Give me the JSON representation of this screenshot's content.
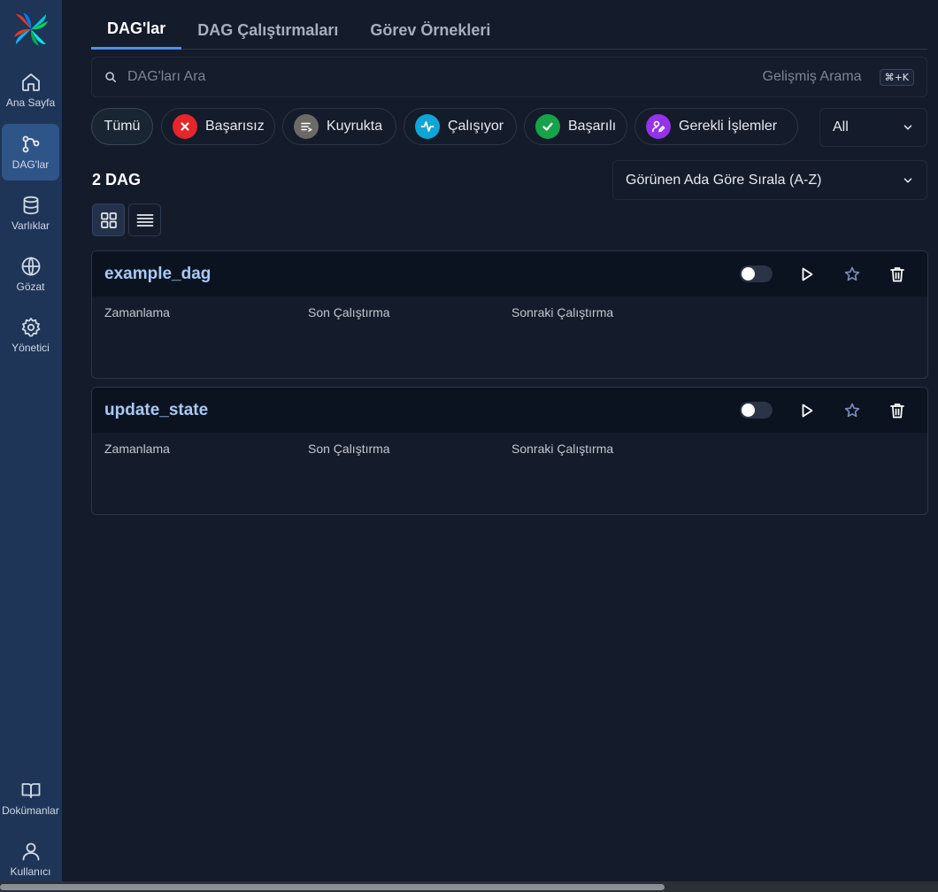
{
  "sidebar": {
    "items": [
      {
        "label": "Ana Sayfa",
        "icon": "home-icon"
      },
      {
        "label": "DAG'lar",
        "icon": "dag-icon",
        "active": true
      },
      {
        "label": "Varlıklar",
        "icon": "database-icon"
      },
      {
        "label": "Gözat",
        "icon": "globe-icon"
      },
      {
        "label": "Yönetici",
        "icon": "gear-icon"
      },
      {
        "label": "Dokümanlar",
        "icon": "book-icon"
      },
      {
        "label": "Kullanıcı",
        "icon": "user-icon"
      }
    ]
  },
  "tabs": [
    {
      "label": "DAG'lar",
      "active": true
    },
    {
      "label": "DAG Çalıştırmaları"
    },
    {
      "label": "Görev Örnekleri"
    }
  ],
  "search": {
    "placeholder": "DAG'ları Ara",
    "advanced_label": "Gelişmiş Arama",
    "shortcut": "⌘+K"
  },
  "filters": {
    "chips": [
      {
        "label": "Tümü",
        "active": true
      },
      {
        "label": "Başarısız",
        "icon": "x-icon",
        "color": "#e5262a"
      },
      {
        "label": "Kuyrukta",
        "icon": "queue-icon",
        "color": "#6b6a67"
      },
      {
        "label": "Çalışıyor",
        "icon": "activity-icon",
        "color": "#0ea5d7"
      },
      {
        "label": "Başarılı",
        "icon": "check-icon",
        "color": "#16a34a"
      },
      {
        "label": "Gerekli İşlemler",
        "icon": "user-pen-icon",
        "color": "#9333ea"
      }
    ],
    "select_value": "All"
  },
  "dag_count": "2 DAG",
  "sort": {
    "value": "Görünen Ada Göre Sırala (A-Z)"
  },
  "columns": {
    "schedule": "Zamanlama",
    "last_run": "Son Çalıştırma",
    "next_run": "Sonraki Çalıştırma"
  },
  "dags": [
    {
      "name": "example_dag",
      "enabled": false
    },
    {
      "name": "update_state",
      "enabled": false
    }
  ],
  "accent_color": "#4f8fe8"
}
